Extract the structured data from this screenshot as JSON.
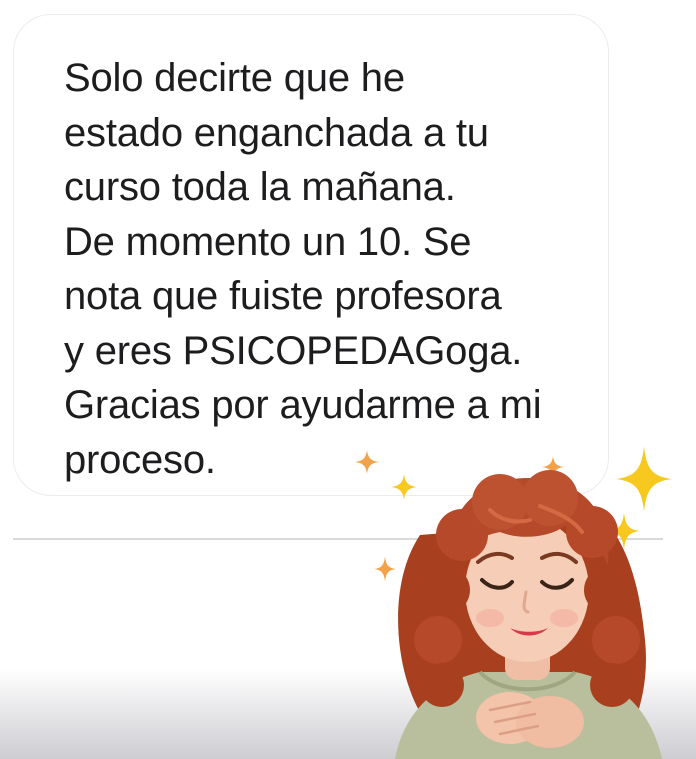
{
  "message": {
    "lines": [
      "Solo decirte que he",
      "estado enganchada a tu",
      "curso toda la mañana.",
      "De momento un 10. Se",
      "nota que fuiste profesora",
      "y eres PSICOPEDAGoga.",
      "Gracias por ayudarme a mi",
      "proceso."
    ]
  },
  "sticker": {
    "icon": "avatar-sticker-heart-hands-icon",
    "sparkle_icon": "sparkle-icon"
  },
  "colors": {
    "bubble_border": "#ececee",
    "text": "#1d1d1f",
    "sparkle_gold": "#f7c81e",
    "sparkle_orange": "#f2a24a",
    "hair": "#b5492a",
    "skin": "#f6cdb6",
    "sweater": "#b9bf9c"
  }
}
